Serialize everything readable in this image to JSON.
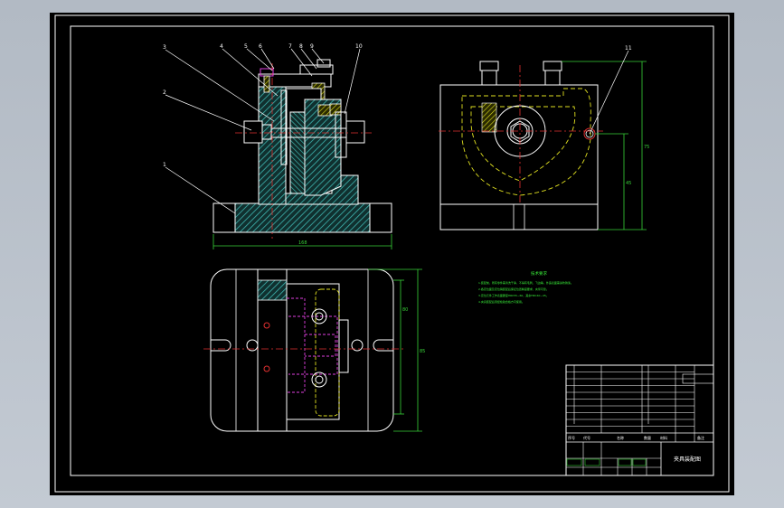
{
  "drawing": {
    "part_numbers": [
      "1",
      "2",
      "3",
      "4",
      "5",
      "6",
      "7",
      "8",
      "9",
      "10",
      "11"
    ],
    "dimensions": {
      "base_width": "168",
      "side_height": "75",
      "side_height_2": "45",
      "plan_depth_1": "85",
      "plan_depth_2": "80"
    },
    "notes": {
      "title": "技术要求",
      "lines": [
        "1.装配前，所有零件需清洗干净，不得有毛刺、飞边等，外露表面需涂防锈漆。",
        "2.各定位面及定位销装配后保证位置精度要求，夹紧可靠。",
        "3.定位元件工作表面硬度HRC55~60，其余HRC40~45。",
        "4.夹具装配后须经检验合格方可使用。"
      ]
    },
    "title_block": {
      "col_headers": [
        "序号",
        "代号",
        "名称",
        "数量",
        "材料",
        "备注"
      ],
      "title": "夹具装配图"
    }
  },
  "colors": {
    "outline": "#ffffff",
    "hatch": "#3fb5b0",
    "dimension": "#38d238",
    "leader": "#ffffff",
    "center": "#e03030",
    "hidden": "#e0e020",
    "magenta": "#e040e0",
    "note_text": "#3af03a"
  }
}
